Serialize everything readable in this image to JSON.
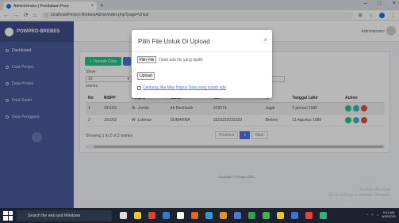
{
  "browser": {
    "tab_title": "Administrator | Pendataan Porp",
    "tab_close": "×",
    "new_tab": "+",
    "url": "localhost/Penpro-Brebes/Admin/index.php?page=Untuk",
    "win_min": "–",
    "win_max": "□",
    "win_close": "×"
  },
  "app": {
    "brand": "POWPRO-BREBES",
    "sidebar": [
      "Dashboard",
      "Data Penpro",
      "Data Proses",
      "Data Santri",
      "Data Pengguna"
    ],
    "admin_name": "Administrator",
    "add_button": "+ Tambah Data",
    "show_label": "Show",
    "show_value": "10",
    "entries_label": "entries",
    "table": {
      "headers": [
        "No",
        "NISPP",
        "Penpro",
        "Nama",
        "NIK",
        "TI",
        "Tanggal Lahir",
        "Action"
      ],
      "rows": [
        [
          "1",
          "101001",
          "Al- Jamile",
          "Ali Muchtadir",
          "323573",
          "Jagal",
          "2 januari 1980"
        ],
        [
          "2",
          "101002",
          "Al- Lukman",
          "SUMARNA",
          "3323233232323",
          "Brebes",
          "11 Agustus 1985"
        ]
      ]
    },
    "showing_text": "Showing 1 to 2 of 2 entries",
    "pager": {
      "prev": "Previous",
      "page": "1",
      "next": "Next"
    },
    "footer": "Copyright © Penpro 2020",
    "watermark_line1": "Activate Windows",
    "watermark_line2": "Go to Settings to activate Windows."
  },
  "modal": {
    "title": "Pilih File Untuk Di Upload",
    "close": "×",
    "file_button": "Pilih File",
    "no_file": "Tidak ada file yang dipilih",
    "upload": "Upload",
    "checkbox_label": "Centang Jika Mau Hapus Data yang sudah ada"
  },
  "taskbar": {
    "search_placeholder": "Search the web and Windows",
    "time": "9:41 AM",
    "date": "6/30/2020"
  },
  "colors": {
    "sidebar": "#4a5a9c",
    "green": "#1cc88a",
    "blue": "#4e73df",
    "red": "#e74a3b",
    "taskbar": "#1b2330"
  }
}
